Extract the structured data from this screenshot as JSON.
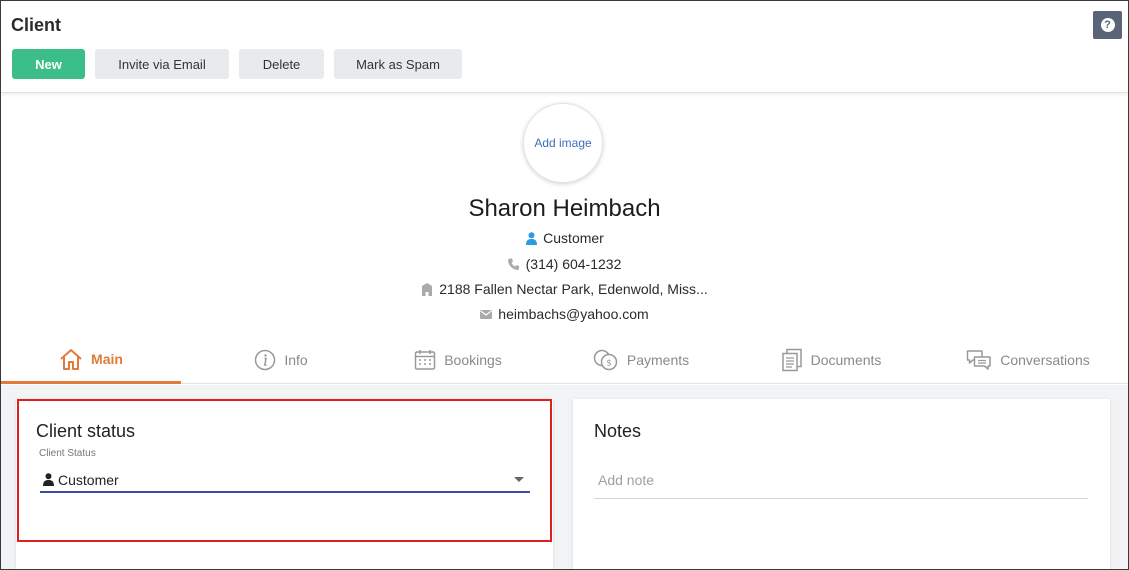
{
  "header": {
    "title": "Client",
    "help_label": "?",
    "buttons": {
      "new": "New",
      "invite": "Invite via Email",
      "delete": "Delete",
      "spam": "Mark as Spam"
    }
  },
  "profile": {
    "add_image": "Add image",
    "name": "Sharon Heimbach",
    "type": "Customer",
    "phone": "(314) 604-1232",
    "address": "2188 Fallen Nectar Park, Edenwold, Miss...",
    "email": "heimbachs@yahoo.com"
  },
  "tabs": [
    {
      "label": "Main",
      "icon": "home-icon",
      "active": true
    },
    {
      "label": "Info",
      "icon": "info-icon"
    },
    {
      "label": "Bookings",
      "icon": "calendar-icon"
    },
    {
      "label": "Payments",
      "icon": "coins-icon"
    },
    {
      "label": "Documents",
      "icon": "documents-icon"
    },
    {
      "label": "Conversations",
      "icon": "chat-icon"
    }
  ],
  "status_card": {
    "title": "Client status",
    "field_label": "Client Status",
    "selected": "Customer"
  },
  "notes_card": {
    "title": "Notes",
    "placeholder": "Add note"
  },
  "colors": {
    "primary_green": "#3cbe88",
    "accent_orange": "#e07b39",
    "link_blue": "#3d6fb8",
    "highlight_red": "#e02020"
  }
}
